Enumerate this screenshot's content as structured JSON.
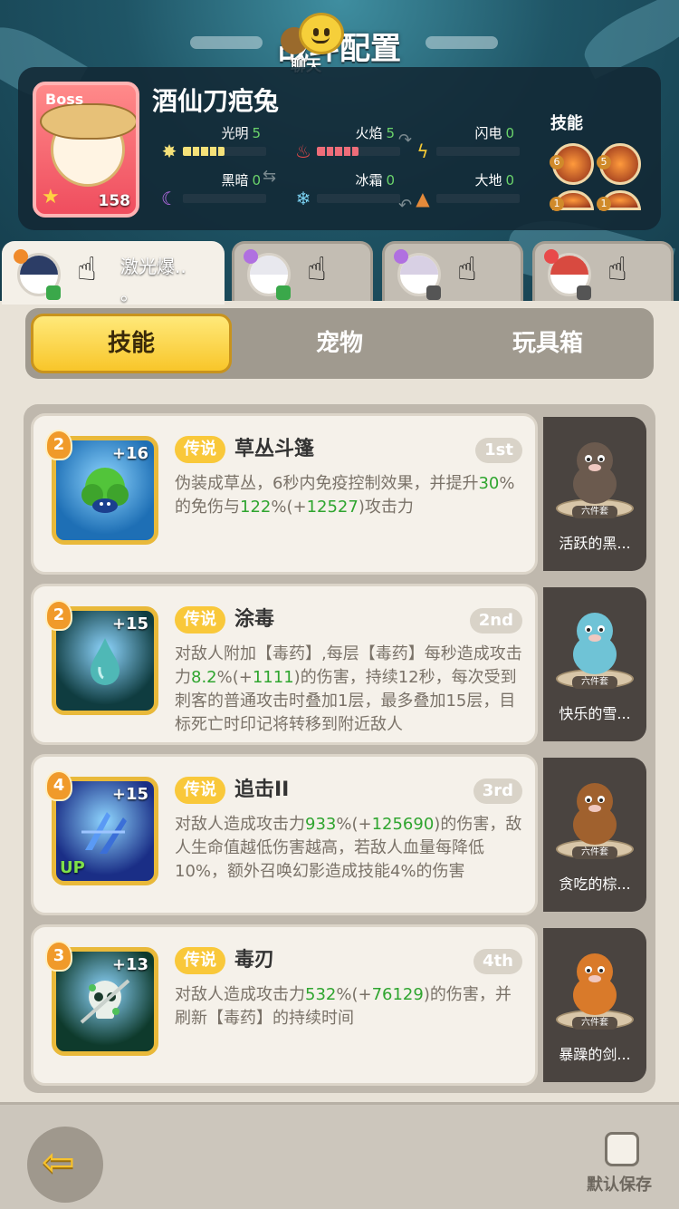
{
  "header": {
    "title": "战斗配置",
    "chat_label": "聊天"
  },
  "boss": {
    "tag": "Boss",
    "name": "酒仙刀疤兔",
    "level": "158",
    "skills_label": "技能",
    "skill_levels": [
      "6",
      "5",
      "1",
      "1"
    ],
    "elements": [
      {
        "name": "光明",
        "value": "5",
        "level": 5,
        "max": 10,
        "icon": "sun-icon",
        "color": "#f5e179"
      },
      {
        "name": "火焰",
        "value": "5",
        "level": 5,
        "max": 10,
        "icon": "flame-icon",
        "color": "#ee6d79"
      },
      {
        "name": "闪电",
        "value": "0",
        "level": 0,
        "max": 10,
        "icon": "lightning-icon",
        "color": "#f5c935"
      },
      {
        "name": "黑暗",
        "value": "0",
        "level": 0,
        "max": 10,
        "icon": "moon-icon",
        "color": "#b070e0"
      },
      {
        "name": "冰霜",
        "value": "0",
        "level": 0,
        "max": 10,
        "icon": "snowflake-icon",
        "color": "#7ad0f0"
      },
      {
        "name": "大地",
        "value": "0",
        "level": 0,
        "max": 10,
        "icon": "mountain-icon",
        "color": "#e58a3a"
      }
    ]
  },
  "characters": [
    {
      "label": "激光爆..\n。",
      "active": true,
      "hair": "#2c3d66",
      "element_color": "#f08a2a",
      "badge_color": "#3aa84a"
    },
    {
      "label": "",
      "active": false,
      "hair": "#e8e8ee",
      "element_color": "#b070e0",
      "badge_color": "#3aa84a"
    },
    {
      "label": "",
      "active": false,
      "hair": "#d8d0e4",
      "element_color": "#b070e0",
      "badge_color": "#555555"
    },
    {
      "label": "",
      "active": false,
      "hair": "#d84a40",
      "element_color": "#e84a4a",
      "badge_color": "#555555"
    }
  ],
  "tabs": [
    {
      "label": "技能",
      "active": true
    },
    {
      "label": "宠物",
      "active": false
    },
    {
      "label": "玩具箱",
      "active": false
    }
  ],
  "skills": [
    {
      "level": "2",
      "plus": "+16",
      "up": "",
      "rarity": "传说",
      "name": "草丛斗篷",
      "rank": "1st",
      "icon_bg": "#1e6fb5",
      "motif": "bush",
      "desc": [
        {
          "t": "伪装成草丛，6秒内免疫控制效果，并提升",
          "hl": false
        },
        {
          "t": "30",
          "hl": true
        },
        {
          "t": "%的免伤与",
          "hl": false
        },
        {
          "t": "122",
          "hl": true
        },
        {
          "t": "%(+",
          "hl": false
        },
        {
          "t": "12527",
          "hl": true
        },
        {
          "t": ")攻击力",
          "hl": false
        }
      ],
      "pet": {
        "name": "活跃的黑...",
        "set": "六件套",
        "color": "#6b5a4e"
      }
    },
    {
      "level": "2",
      "plus": "+15",
      "up": "",
      "rarity": "传说",
      "name": "涂毒",
      "rank": "2nd",
      "icon_bg": "#0f3c40",
      "motif": "drop",
      "desc": [
        {
          "t": "对敌人附加【毒药】,每层【毒药】每秒造成攻击力",
          "hl": false
        },
        {
          "t": "8.2",
          "hl": true
        },
        {
          "t": "%(+",
          "hl": false
        },
        {
          "t": "1111",
          "hl": true
        },
        {
          "t": ")的伤害，持续12秒，每次受到刺客的普通攻击时叠加1层，最多叠加15层，目标死亡时印记将转移到附近敌人",
          "hl": false
        }
      ],
      "pet": {
        "name": "快乐的雪...",
        "set": "六件套",
        "color": "#6fc3d6"
      }
    },
    {
      "level": "4",
      "plus": "+15",
      "up": "UP",
      "rarity": "传说",
      "name": "追击II",
      "rank": "3rd",
      "icon_bg": "#1a2e86",
      "motif": "dash",
      "desc": [
        {
          "t": "对敌人造成攻击力",
          "hl": false
        },
        {
          "t": "933",
          "hl": true
        },
        {
          "t": "%(+",
          "hl": false
        },
        {
          "t": "125690",
          "hl": true
        },
        {
          "t": ")的伤害，敌人生命值越低伤害越高，若敌人血量每降低10%，额外召唤幻影造成技能4%的伤害",
          "hl": false
        }
      ],
      "pet": {
        "name": "贪吃的棕...",
        "set": "六件套",
        "color": "#a0612e"
      }
    },
    {
      "level": "3",
      "plus": "+13",
      "up": "",
      "rarity": "传说",
      "name": "毒刃",
      "rank": "4th",
      "icon_bg": "#0e3a2c",
      "motif": "skull",
      "desc": [
        {
          "t": "对敌人造成攻击力",
          "hl": false
        },
        {
          "t": "532",
          "hl": true
        },
        {
          "t": "%(+",
          "hl": false
        },
        {
          "t": "76129",
          "hl": true
        },
        {
          "t": ")的伤害，并刷新【毒药】的持续时间",
          "hl": false
        }
      ],
      "pet": {
        "name": "暴躁的剑...",
        "set": "六件套",
        "color": "#d97a2a"
      }
    }
  ],
  "footer": {
    "save_label": "默认保存",
    "save_checked": false,
    "back_icon": "back-arrow-icon"
  }
}
